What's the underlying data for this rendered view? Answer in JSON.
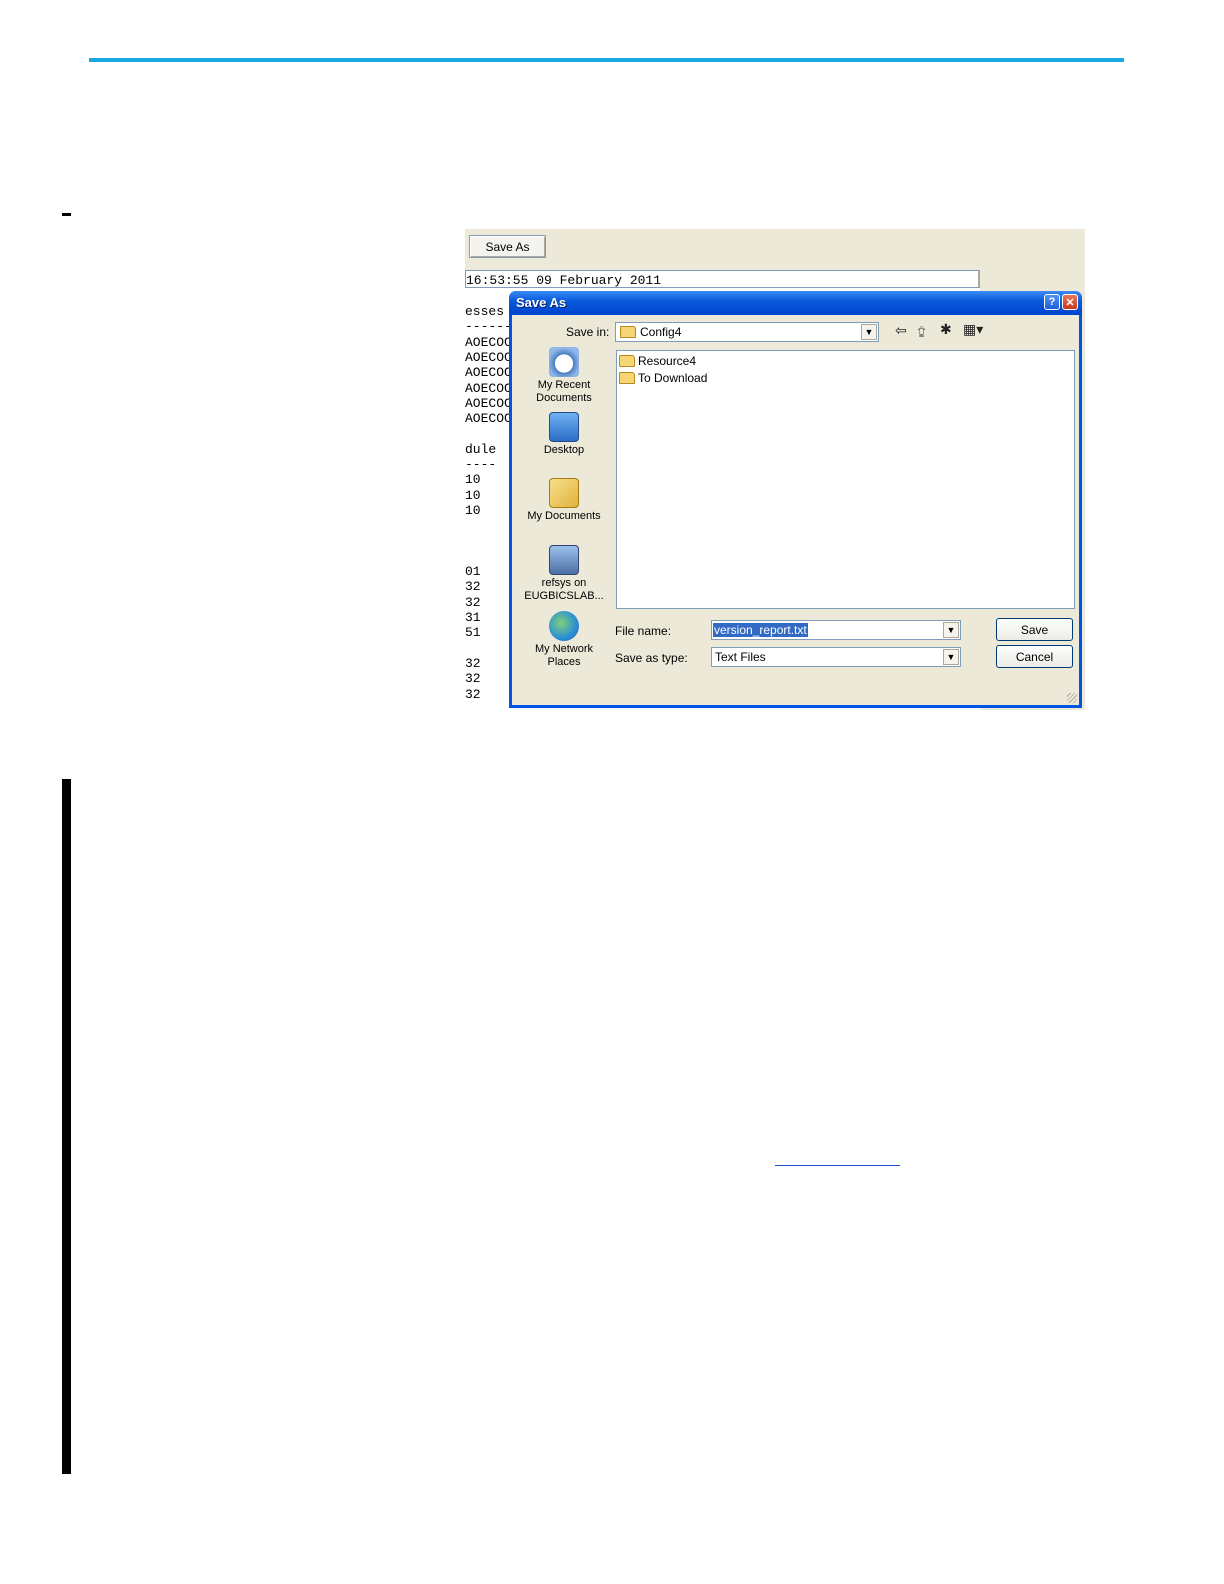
{
  "background_window": {
    "save_as_button": "Save As",
    "timestamp": "16:53:55 09 February 2011",
    "lines": [
      {
        "text": "esses",
        "row": 0
      },
      {
        "text": "------",
        "row": 1
      },
      {
        "text": "AOECOC",
        "row": 2
      },
      {
        "text": "AOECOC",
        "row": 3
      },
      {
        "text": "AOECOC",
        "row": 4
      },
      {
        "text": "AOECOC",
        "row": 5
      },
      {
        "text": "AOECOC",
        "row": 6
      },
      {
        "text": "AOECOC",
        "row": 7
      },
      {
        "text": "dule",
        "row": 9
      },
      {
        "text": "----",
        "row": 10
      },
      {
        "text": "10",
        "row": 11
      },
      {
        "text": "10",
        "row": 12
      },
      {
        "text": "10",
        "row": 13
      },
      {
        "text": "01",
        "row": 17
      },
      {
        "text": "32",
        "row": 18
      },
      {
        "text": "32",
        "row": 19
      },
      {
        "text": "31",
        "row": 20
      },
      {
        "text": "51",
        "row": 21
      },
      {
        "text": "32",
        "row": 23
      },
      {
        "text": "32",
        "row": 24
      },
      {
        "text": "32",
        "row": 25
      }
    ]
  },
  "dialog": {
    "title": "Save As",
    "help_button": "?",
    "close_button": "✕",
    "save_in_label": "Save in:",
    "save_in_value": "Config4",
    "places": [
      {
        "label": "My Recent Documents",
        "icon": "recent-documents-icon"
      },
      {
        "label": "Desktop",
        "icon": "desktop-icon"
      },
      {
        "label": "My Documents",
        "icon": "my-documents-icon"
      },
      {
        "label": "refsys on EUGBICSLAB...",
        "icon": "network-drive-icon"
      },
      {
        "label": "My Network Places",
        "icon": "network-places-icon"
      }
    ],
    "files": [
      {
        "name": "Resource4",
        "icon": "folder-icon"
      },
      {
        "name": "To Download",
        "icon": "folder-icon"
      }
    ],
    "file_name_label": "File name:",
    "file_name_value": "version_report.txt",
    "save_as_type_label": "Save as type:",
    "save_as_type_value": "Text Files",
    "save_button": "Save",
    "cancel_button": "Cancel"
  },
  "colors": {
    "top_rule": "#1aa8e0",
    "title_bar": "#0054e3",
    "selection": "#316ac5"
  }
}
